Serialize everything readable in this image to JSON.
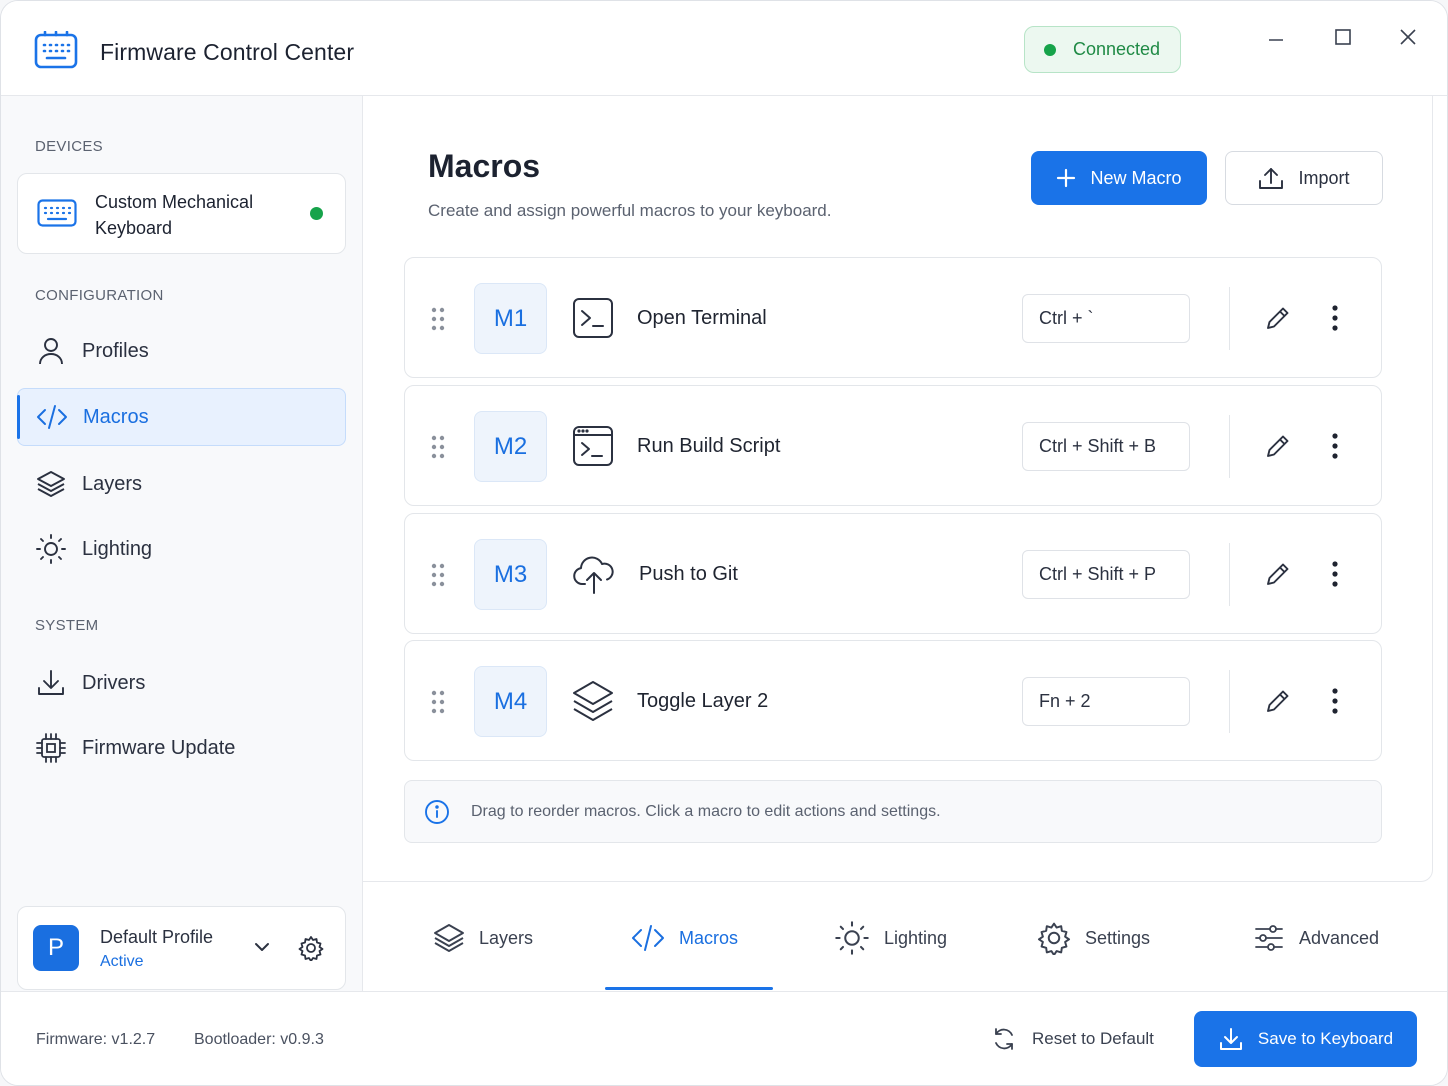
{
  "app": {
    "title": "Firmware Control Center",
    "status": "Connected",
    "accent_color": "#1a73e8",
    "status_color": "#16a34a"
  },
  "sidebar": {
    "devices_label": "DEVICES",
    "device": {
      "name": "Custom Mechanical Keyboard",
      "icon": "keyboard-icon",
      "online": true
    },
    "config_label": "CONFIGURATION",
    "config_items": [
      {
        "label": "Profiles",
        "icon": "user-icon"
      },
      {
        "label": "Macros",
        "icon": "code-icon",
        "active": true
      },
      {
        "label": "Layers",
        "icon": "layers-icon"
      },
      {
        "label": "Lighting",
        "icon": "sun-icon"
      }
    ],
    "system_label": "SYSTEM",
    "system_items": [
      {
        "label": "Drivers",
        "icon": "download-icon"
      },
      {
        "label": "Firmware Update",
        "icon": "chip-icon"
      }
    ],
    "profile": {
      "avatar_letter": "P",
      "name": "Default Profile",
      "status": "Active"
    }
  },
  "main": {
    "title": "Macros",
    "subtitle": "Create and assign powerful macros to your keyboard.",
    "new_button": "New Macro",
    "import_button": "Import",
    "macros": [
      {
        "key": "M1",
        "name": "Open Terminal",
        "shortcut": "Ctrl + `",
        "icon": "terminal-icon"
      },
      {
        "key": "M2",
        "name": "Run Build Script",
        "shortcut": "Ctrl + Shift + B",
        "icon": "terminal-window-icon"
      },
      {
        "key": "M3",
        "name": "Push to Git",
        "shortcut": "Ctrl + Shift + P",
        "icon": "cloud-upload-icon"
      },
      {
        "key": "M4",
        "name": "Toggle Layer 2",
        "shortcut": "Fn + 2",
        "icon": "layers-icon"
      }
    ],
    "info": "Drag to reorder macros. Click a macro to edit actions and settings."
  },
  "tabs": [
    {
      "label": "Layers",
      "icon": "layers-icon"
    },
    {
      "label": "Macros",
      "icon": "code-icon",
      "active": true
    },
    {
      "label": "Lighting",
      "icon": "sun-icon"
    },
    {
      "label": "Settings",
      "icon": "gear-icon"
    },
    {
      "label": "Advanced",
      "icon": "sliders-icon"
    }
  ],
  "footer": {
    "firmware": "Firmware: v1.2.7",
    "bootloader": "Bootloader: v0.9.3",
    "reset_button": "Reset to Default",
    "save_button": "Save to Keyboard"
  }
}
